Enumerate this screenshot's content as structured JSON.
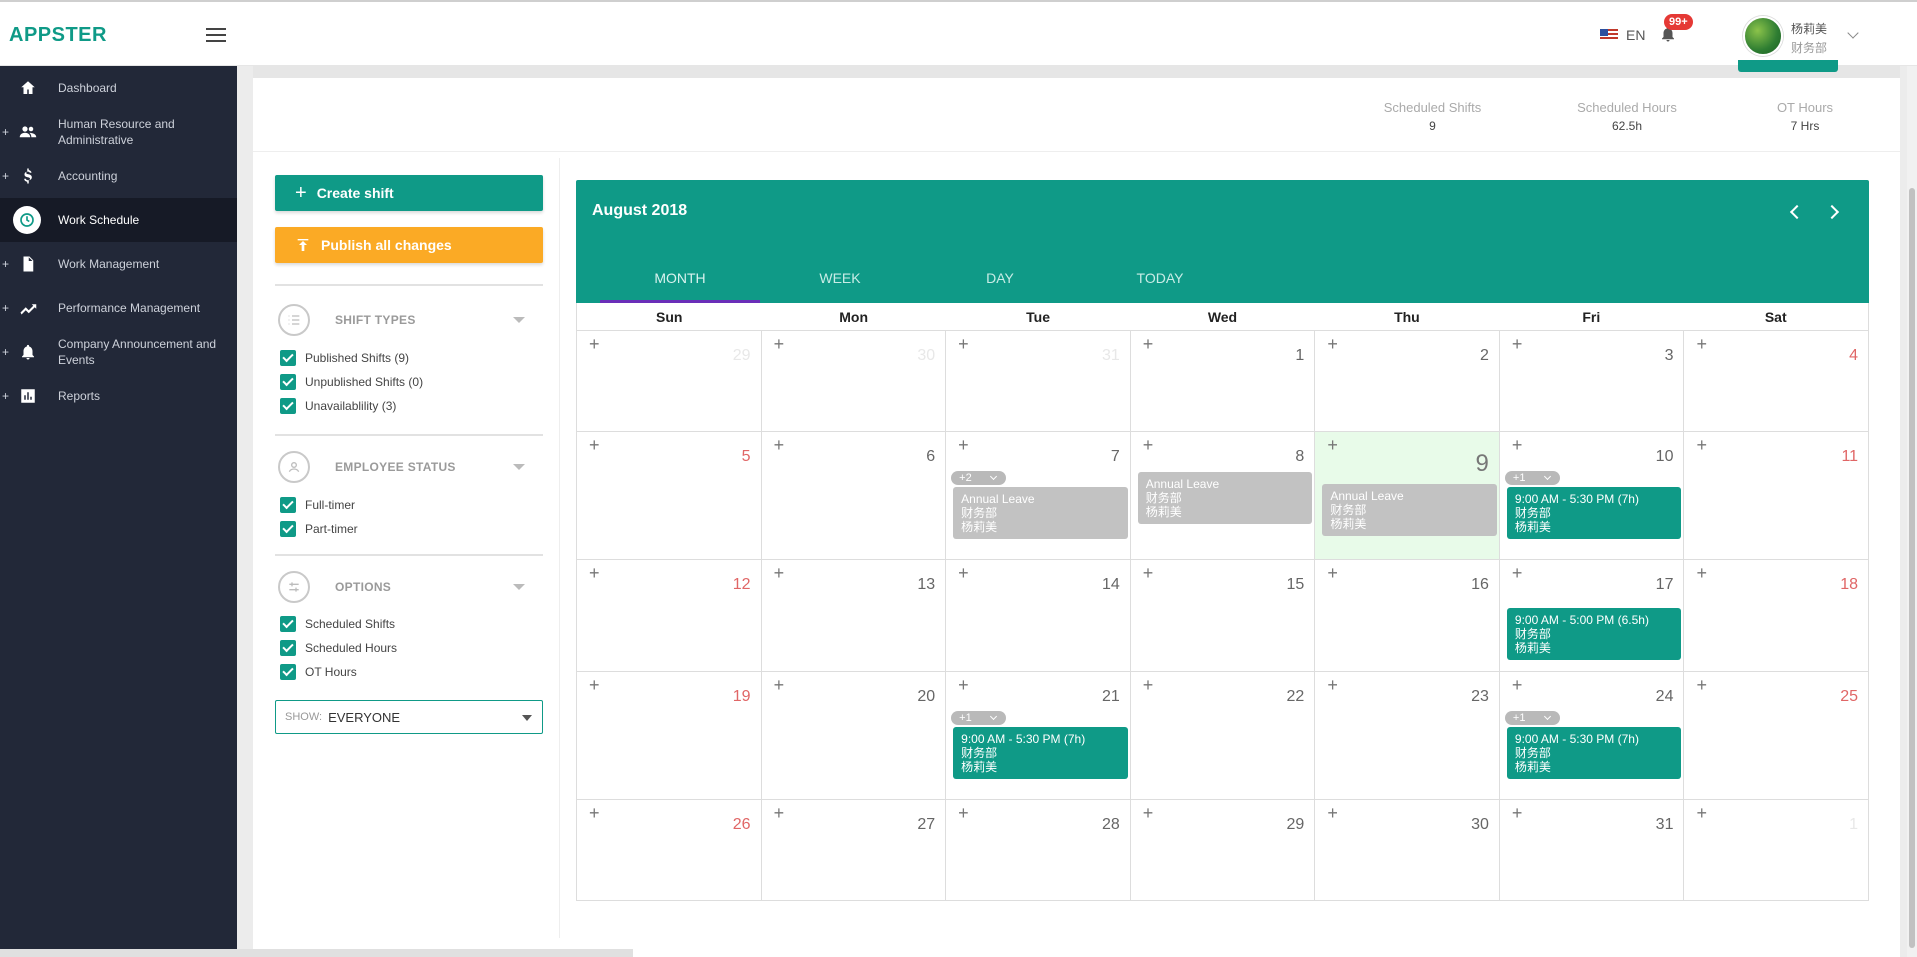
{
  "app": {
    "logo": "APPSTER",
    "lang": "EN",
    "notifications": "99+"
  },
  "user": {
    "name": "杨莉美",
    "dept": "财务部"
  },
  "sidebar": {
    "items": [
      {
        "label": "Dashboard",
        "icon": "home-icon",
        "expandable": false,
        "active": false
      },
      {
        "label": "Human Resource and Administrative",
        "icon": "people-icon",
        "expandable": true,
        "active": false
      },
      {
        "label": "Accounting",
        "icon": "dollar-icon",
        "expandable": true,
        "active": false
      },
      {
        "label": "Work Schedule",
        "icon": "clock-icon",
        "expandable": false,
        "active": true
      },
      {
        "label": "Work Management",
        "icon": "document-icon",
        "expandable": true,
        "active": false
      },
      {
        "label": "Performance Management",
        "icon": "trend-icon",
        "expandable": true,
        "active": false
      },
      {
        "label": "Company Announcement and Events",
        "icon": "bell-icon",
        "expandable": true,
        "active": false
      },
      {
        "label": "Reports",
        "icon": "chart-icon",
        "expandable": true,
        "active": false
      }
    ]
  },
  "stats": [
    {
      "label": "Scheduled Shifts",
      "value": "9"
    },
    {
      "label": "Scheduled Hours",
      "value": "62.5h"
    },
    {
      "label": "OT Hours",
      "value": "7 Hrs"
    }
  ],
  "panel": {
    "create_label": "Create shift",
    "publish_label": "Publish all changes",
    "shift_types": {
      "title": "SHIFT TYPES",
      "items": [
        "Published Shifts (9)",
        "Unpublished Shifts (0)",
        "Unavailablility (3)"
      ]
    },
    "employee_status": {
      "title": "EMPLOYEE STATUS",
      "items": [
        "Full-timer",
        "Part-timer"
      ]
    },
    "options": {
      "title": "OPTIONS",
      "items": [
        "Scheduled Shifts",
        "Scheduled Hours",
        "OT Hours"
      ]
    },
    "show": {
      "label": "SHOW:",
      "value": "EVERYONE"
    }
  },
  "calendar": {
    "title": "August 2018",
    "tabs": [
      "MONTH",
      "WEEK",
      "DAY",
      "TODAY"
    ],
    "active_tab": "MONTH",
    "days_of_week": [
      "Sun",
      "Mon",
      "Tue",
      "Wed",
      "Thu",
      "Fri",
      "Sat"
    ],
    "today": "9",
    "weeks": [
      {
        "days": [
          {
            "num": "29",
            "other": true
          },
          {
            "num": "30",
            "other": true
          },
          {
            "num": "31",
            "other": true
          },
          {
            "num": "1"
          },
          {
            "num": "2"
          },
          {
            "num": "3"
          },
          {
            "num": "4",
            "weekend": true
          }
        ]
      },
      {
        "days": [
          {
            "num": "5",
            "weekend": true
          },
          {
            "num": "6"
          },
          {
            "num": "7",
            "more": "+2",
            "events": [
              {
                "type": "leave",
                "lines": [
                  "Annual Leave",
                  "财务部",
                  "杨莉美"
                ]
              }
            ]
          },
          {
            "num": "8",
            "events": [
              {
                "type": "leave",
                "lines": [
                  "Annual Leave",
                  "财务部",
                  "杨莉美"
                ]
              }
            ]
          },
          {
            "num": "9",
            "today": true,
            "events": [
              {
                "type": "leave",
                "lines": [
                  "Annual Leave",
                  "财务部",
                  "杨莉美"
                ]
              }
            ]
          },
          {
            "num": "10",
            "more": "+1",
            "events": [
              {
                "type": "shift",
                "lines": [
                  "9:00 AM - 5:30 PM (7h)",
                  "财务部",
                  "杨莉美"
                ]
              }
            ]
          },
          {
            "num": "11",
            "weekend": true
          }
        ]
      },
      {
        "days": [
          {
            "num": "12",
            "weekend": true
          },
          {
            "num": "13"
          },
          {
            "num": "14"
          },
          {
            "num": "15"
          },
          {
            "num": "16"
          },
          {
            "num": "17",
            "events": [
              {
                "type": "shift",
                "lines": [
                  "9:00 AM - 5:00 PM (6.5h)",
                  "财务部",
                  "杨莉美"
                ]
              }
            ]
          },
          {
            "num": "18",
            "weekend": true
          }
        ]
      },
      {
        "days": [
          {
            "num": "19",
            "weekend": true
          },
          {
            "num": "20"
          },
          {
            "num": "21",
            "more": "+1",
            "events": [
              {
                "type": "shift",
                "lines": [
                  "9:00 AM - 5:30 PM (7h)",
                  "财务部",
                  "杨莉美"
                ]
              }
            ]
          },
          {
            "num": "22"
          },
          {
            "num": "23"
          },
          {
            "num": "24",
            "more": "+1",
            "events": [
              {
                "type": "shift",
                "lines": [
                  "9:00 AM - 5:30 PM (7h)",
                  "财务部",
                  "杨莉美"
                ]
              }
            ]
          },
          {
            "num": "25",
            "weekend": true
          }
        ]
      },
      {
        "days": [
          {
            "num": "26",
            "weekend": true
          },
          {
            "num": "27"
          },
          {
            "num": "28"
          },
          {
            "num": "29"
          },
          {
            "num": "30"
          },
          {
            "num": "31"
          },
          {
            "num": "1",
            "other": true
          }
        ]
      }
    ]
  },
  "colors": {
    "accent": "#0f9a87",
    "warning": "#fbaa25",
    "sidebar": "#222838",
    "weekend": "#e06666",
    "leave": "#c2c2c2",
    "today": "#e8fbe9"
  }
}
